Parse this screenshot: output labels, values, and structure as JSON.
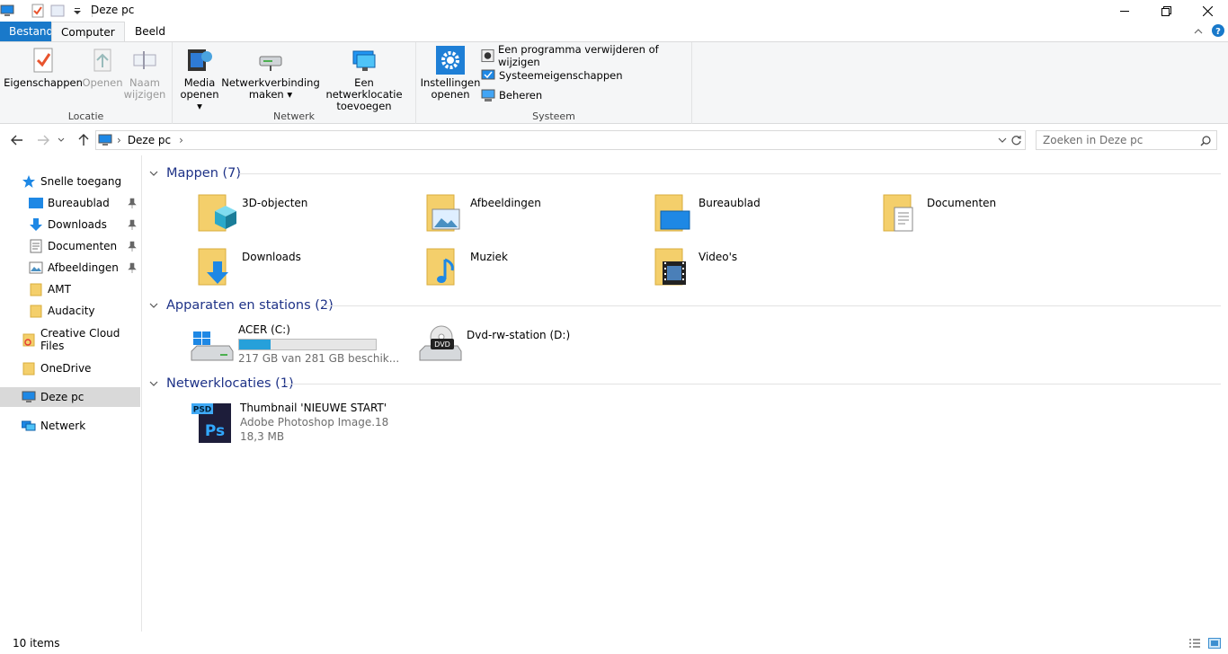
{
  "window": {
    "title": "Deze pc",
    "qat_icons": [
      "computer-icon",
      "properties-icon",
      "new-folder-icon",
      "customize-dropdown-icon"
    ],
    "controls": [
      "minimize",
      "restore",
      "close"
    ]
  },
  "tabs": {
    "file": "Bestand",
    "computer": "Computer",
    "view": "Beeld"
  },
  "ribbon": {
    "groups": {
      "location": "Locatie",
      "network": "Netwerk",
      "system": "Systeem"
    },
    "properties": "Eigenschappen",
    "open": "Openen",
    "rename_1": "Naam",
    "rename_2": "wijzigen",
    "media_1": "Media",
    "media_2": "openen",
    "netdrive_1": "Netwerkverbinding",
    "netdrive_2": "maken",
    "netloc_1": "Een netwerklocatie",
    "netloc_2": "toevoegen",
    "settings_1": "Instellingen",
    "settings_2": "openen",
    "uninstall": "Een programma verwijderen of wijzigen",
    "sysprops": "Systeemeigenschappen",
    "manage": "Beheren"
  },
  "address": {
    "path": "Deze pc"
  },
  "search": {
    "placeholder": "Zoeken in Deze pc"
  },
  "sidebar": {
    "quick": "Snelle toegang",
    "items": [
      {
        "label": "Bureaublad",
        "pinned": true
      },
      {
        "label": "Downloads",
        "pinned": true
      },
      {
        "label": "Documenten",
        "pinned": true
      },
      {
        "label": "Afbeeldingen",
        "pinned": true
      },
      {
        "label": "AMT",
        "pinned": false
      },
      {
        "label": "Audacity",
        "pinned": false
      }
    ],
    "creative": "Creative Cloud Files",
    "onedrive": "OneDrive",
    "thispc": "Deze pc",
    "network": "Netwerk"
  },
  "groups": {
    "folders": "Mappen (7)",
    "devices": "Apparaten en stations (2)",
    "netlocs": "Netwerklocaties (1)"
  },
  "folders": [
    "3D-objecten",
    "Afbeeldingen",
    "Bureaublad",
    "Documenten",
    "Downloads",
    "Muziek",
    "Video's"
  ],
  "drives": {
    "c_name": "ACER (C:)",
    "c_free": "217 GB van 281 GB beschik...",
    "c_used_fraction": 0.23,
    "d_name": "Dvd-rw-station (D:)"
  },
  "netloc_item": {
    "name": "Thumbnail 'NIEUWE START'",
    "type": "Adobe Photoshop Image.18",
    "size": "18,3 MB"
  },
  "status": {
    "count": "10 items"
  },
  "colors": {
    "accent": "#1979ca",
    "group_header": "#1e3287",
    "folder": "#f4cf6b",
    "progress": "#26a0da"
  }
}
